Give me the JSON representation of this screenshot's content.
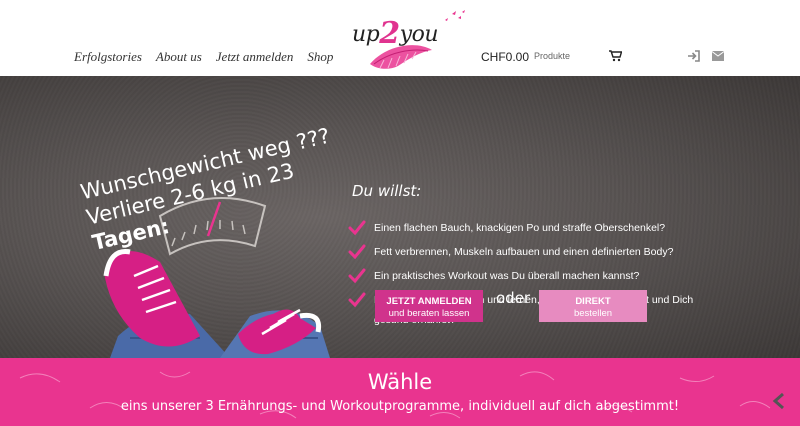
{
  "nav": {
    "items": [
      {
        "label": "Erfolgstories"
      },
      {
        "label": "About us"
      },
      {
        "label": "Jetzt anmelden"
      },
      {
        "label": "Shop"
      }
    ]
  },
  "logo": {
    "part1": "up",
    "part2": "2",
    "part3": "you"
  },
  "cart": {
    "price": "CHF0.00",
    "label": "Produkte"
  },
  "icons": {
    "cart": "shopping-cart-icon",
    "login": "sign-in-icon",
    "mail": "envelope-icon"
  },
  "hero": {
    "chalk": {
      "line1": "Wunschgewicht weg ???",
      "line2": "Verliere 2-6 kg in 23",
      "line3": "Tagen:"
    },
    "willst": "Du willst:",
    "items": [
      {
        "text": "Einen flachen Bauch, knackigen Po und straffe Oberschenkel?"
      },
      {
        "text": "Fett verbrennen, Muskeln aufbauen und einen definierten Body?"
      },
      {
        "text": "Ein praktisches Workout was Du überall machen kannst?"
      },
      {
        "text": "Deinen Lifestyle ändern und lernen, wie Du richtig trainierst und Dich gesund ernährst?"
      }
    ],
    "cta1": {
      "line1": "JETZT ANMELDEN",
      "line2": "und beraten lassen"
    },
    "oder": "oder",
    "cta2": {
      "line1": "DIREKT",
      "line2": "bestellen"
    }
  },
  "banner": {
    "title": "Wähle",
    "subtitle": "eins unserer 3 Ernährungs- und Workoutprogramme, individuell auf dich abgestimmt!"
  },
  "colors": {
    "accent": "#e9348f",
    "button_primary": "#d0338c",
    "button_secondary": "#e78bc0",
    "hero_bg": "#585352"
  }
}
